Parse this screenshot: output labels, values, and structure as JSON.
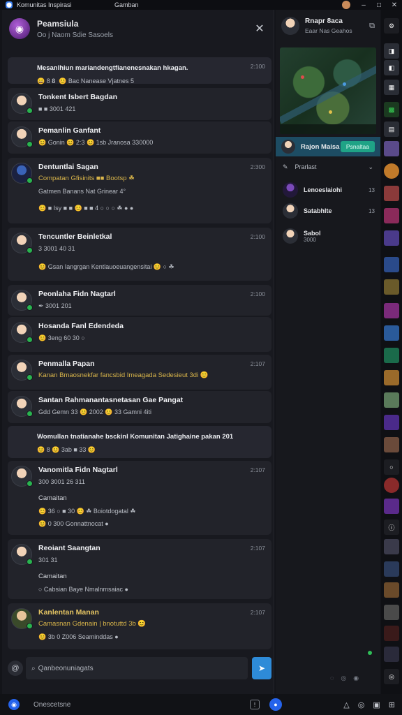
{
  "titlebar": {
    "title": "Komunitas Inspirasi",
    "center": "Gamban",
    "minimize": "–",
    "maximize": "□",
    "close": "✕"
  },
  "chat_header": {
    "title": "Peamsiula",
    "subtitle": "Oo j Naom Sdie Sasoels",
    "close": "✕"
  },
  "messages": [
    {
      "type": "banner",
      "text": "Mesanlhiun mariandengtfianenesnakan hkagan.",
      "time": "2:100",
      "reactions": "😄 8 𝟖 ️ 😊 Bac Nanease Vjatnes 5"
    },
    {
      "type": "msg",
      "name": "Tonkent Isbert Bagdan",
      "line1": "■ ■ 3001 421",
      "line2": "",
      "time": ""
    },
    {
      "type": "msg",
      "name": "Pemanlin Ganfant",
      "line1": "😊 Gonin 😊 2:3 😊  1sb Jranosa 330000",
      "line2": "",
      "time": ""
    },
    {
      "type": "msg",
      "name": "Dentuntlai Sagan",
      "line1": "Compatan Gfisinits ■■ Bootsp ☘",
      "line2": "Gatmen Banans Nat Grinear 4°",
      "line3": "😊 ■ Isy ■ ■ 😊 ■ ■ 4 ○ ○ ○ ☘ ● ●",
      "time": "2:300"
    },
    {
      "type": "msg",
      "name": "Tencuntler Beinletkal",
      "line1": "3 3001 40 31",
      "line2": "😊  Gsan Iangrgan Kentlauoeuangensitai 😊 ○ ☘",
      "time": "2:100"
    },
    {
      "type": "msg",
      "name": "Peonlaha Fidn Nagtarl",
      "line1": "✒ 3001 201",
      "time": "2:100"
    },
    {
      "type": "msg",
      "name": "Hosanda Fanl Edendeda",
      "line1": "😊  3eng  60 30 ○",
      "time": ""
    },
    {
      "type": "msg",
      "name": "Penmalla Papan",
      "line1": "Kanan Bmaosnekfar fancsbid Imeagada Sedesieut 3di 😊",
      "time": "2:107"
    },
    {
      "type": "msg",
      "name": "Santan Rahmanantasnetasan Gae Pangat",
      "line1": "Gdd Gemn 33 😊 2002 😊 33 Gamni 4iti",
      "time": ""
    },
    {
      "type": "banner",
      "text": "Womullan tnatianahe bsckinl Komunitan Jatighaine pakan 201",
      "reactions": "😊 8 😊 3ab ■ 33 😊",
      "time": ""
    },
    {
      "type": "msg",
      "name": "Vanomitla Fidn Nagtarl",
      "line1": "300 3001 26 311",
      "line2": "Camaitan",
      "line3": "😊 36 ○ ■ 30 😊 ☘  Boiotdogatal ☘",
      "line4": "😊  0 300 Gonnattnocat ●",
      "time": "2:107"
    },
    {
      "type": "msg",
      "name": "Reoiant Saangtan",
      "line1": "301 31",
      "line2": "Camaitan",
      "line3": "○  Cabsian Baye Nmalnmsaiac ●",
      "time": "2:107"
    },
    {
      "type": "msg",
      "name": "Kanlentan Manan",
      "line1": "Camasnan Gdenain  | bnotuttd 3b 😊",
      "line2": "😊 3b  0 Z006 Seaminddas ●",
      "time": "2:107"
    }
  ],
  "composer": {
    "attach_icon": "at-icon",
    "placeholder": "Qanbeonuniagats",
    "send_icon": "send-icon"
  },
  "bottombar": {
    "search_text": "Onescetsne",
    "tools": [
      "△",
      "◎",
      "▣",
      "⊞"
    ]
  },
  "right_panel": {
    "title": "Rnapr 8aca",
    "subtitle": "Eaar Nas Geahos",
    "live_name": "Rajon Maisa",
    "live_button": "Psnaltaa",
    "filter_label": "Prarlast",
    "rows": [
      {
        "name": "Lenoeslaiohi",
        "count": "13"
      },
      {
        "name": "Satabhlte",
        "count": "13"
      },
      {
        "name": "Sabol",
        "sub": "3000"
      }
    ]
  },
  "colors": {
    "accent": "#2e8bd8",
    "online": "#29b34f",
    "live_bg": "#1d4c63",
    "live_button": "#1fa386"
  }
}
